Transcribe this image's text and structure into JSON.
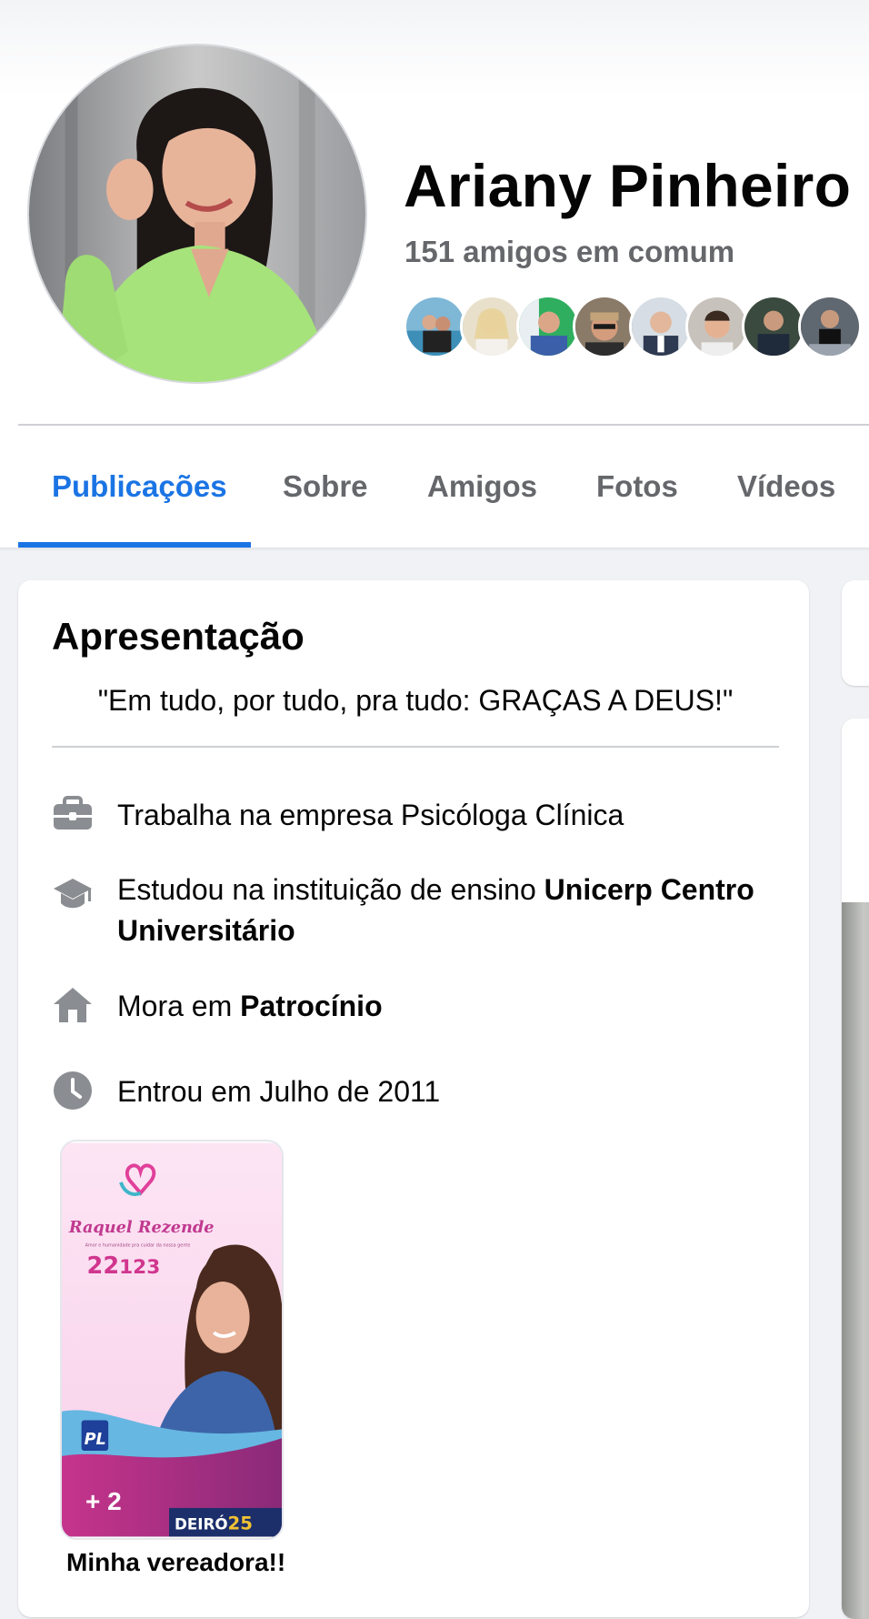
{
  "profile": {
    "name": "Ariany Pinheiro",
    "mutual_friends": "151 amigos em comum"
  },
  "tabs": [
    {
      "label": "Publicações",
      "active": true
    },
    {
      "label": "Sobre",
      "active": false
    },
    {
      "label": "Amigos",
      "active": false
    },
    {
      "label": "Fotos",
      "active": false
    },
    {
      "label": "Vídeos",
      "active": false
    }
  ],
  "intro": {
    "title": "Apresentação",
    "bio": "\"Em tudo, por tudo, pra tudo: GRAÇAS A DEUS!\"",
    "work": {
      "prefix": "Trabalha na empresa ",
      "value": "Psicóloga Clínica",
      "icon": "briefcase-icon"
    },
    "education": {
      "prefix": "Estudou na instituição de ensino ",
      "value": "Unicerp Centro Universitário",
      "icon": "graduation-cap-icon"
    },
    "location": {
      "prefix": "Mora em ",
      "value": "Patrocínio",
      "icon": "home-icon"
    },
    "joined": {
      "prefix": "Entrou em ",
      "value": "Julho de 2011",
      "icon": "clock-icon"
    }
  },
  "featured": {
    "count_label": "+ 2",
    "caption": "Minha vereadora!!",
    "poster_texts": {
      "candidate": "Raquel Rezende",
      "number_main": "22",
      "number_rest": "123",
      "party": "PL",
      "mayor_banner": "DEIRÓ",
      "mayor_number": "25"
    }
  },
  "colors": {
    "accent": "#1b74e4",
    "secondary_text": "#65676b",
    "page_bg": "#f0f2f5"
  }
}
